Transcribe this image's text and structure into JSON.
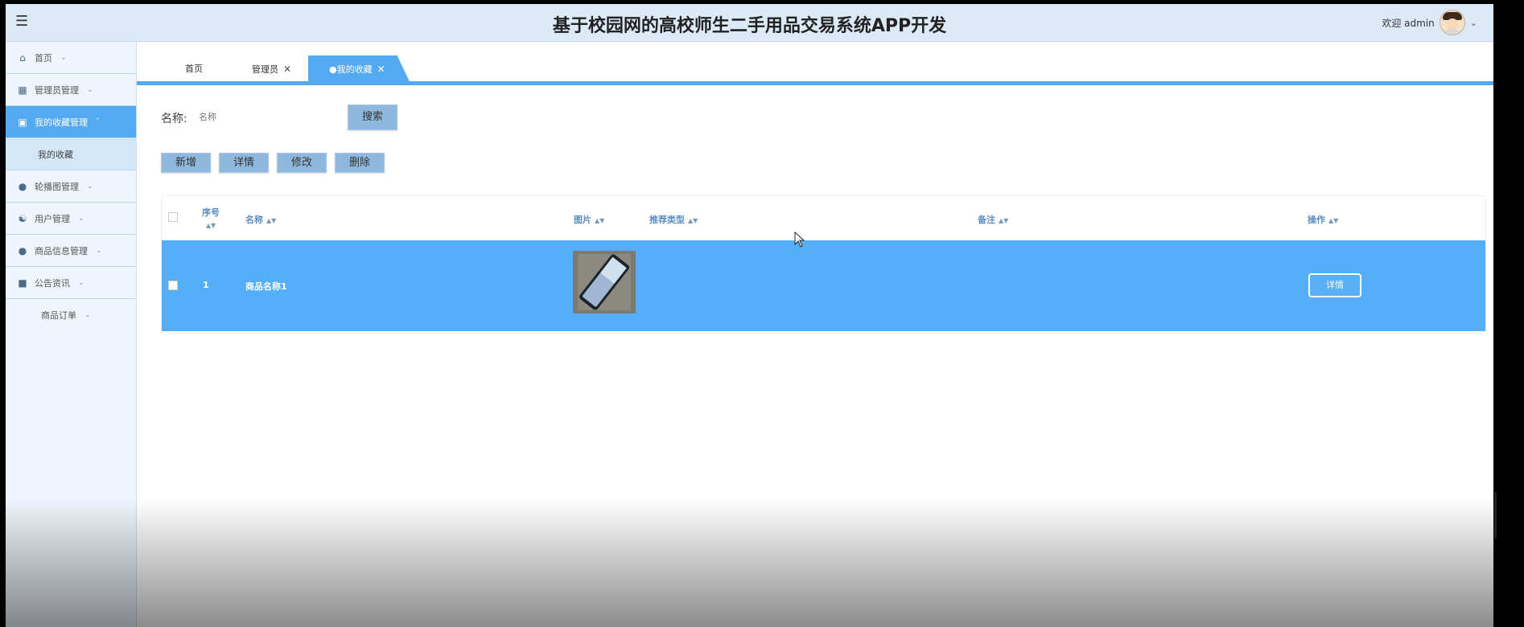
{
  "header": {
    "title": "基于校园网的高校师生二手用品交易系统APP开发",
    "welcome": "欢迎 admin"
  },
  "sidebar": {
    "items": [
      {
        "label": "首页",
        "icon": "home-icon"
      },
      {
        "label": "管理员管理",
        "icon": "grid-icon"
      },
      {
        "label": "我的收藏管理",
        "icon": "card-icon",
        "active": true
      },
      {
        "label": "我的收藏",
        "sub": true
      },
      {
        "label": "轮播图管理",
        "icon": "circle-icon"
      },
      {
        "label": "用户管理",
        "icon": "user-icon"
      },
      {
        "label": "商品信息管理",
        "icon": "circle-icon"
      },
      {
        "label": "公告资讯",
        "icon": "briefcase-icon"
      },
      {
        "label": "商品订单",
        "icon": ""
      }
    ]
  },
  "tabs": [
    {
      "label": "首页"
    },
    {
      "label": "管理员"
    },
    {
      "label": "●我的收藏",
      "active": true
    }
  ],
  "search": {
    "label": "名称:",
    "placeholder": "名称",
    "button": "搜索"
  },
  "actions": {
    "add": "新增",
    "detail": "详情",
    "edit": "修改",
    "delete": "删除"
  },
  "table": {
    "columns": {
      "index": "序号",
      "name": "名称",
      "image": "图片",
      "type": "推荐类型",
      "remark": "备注",
      "ops": "操作"
    },
    "rows": [
      {
        "index": "1",
        "name": "商品名称1",
        "type": "",
        "remark": "",
        "op_label": "详情"
      }
    ]
  },
  "colors": {
    "accent": "#55a9f0",
    "header_bg": "#dce9f7",
    "row_selected": "#55aff8"
  }
}
